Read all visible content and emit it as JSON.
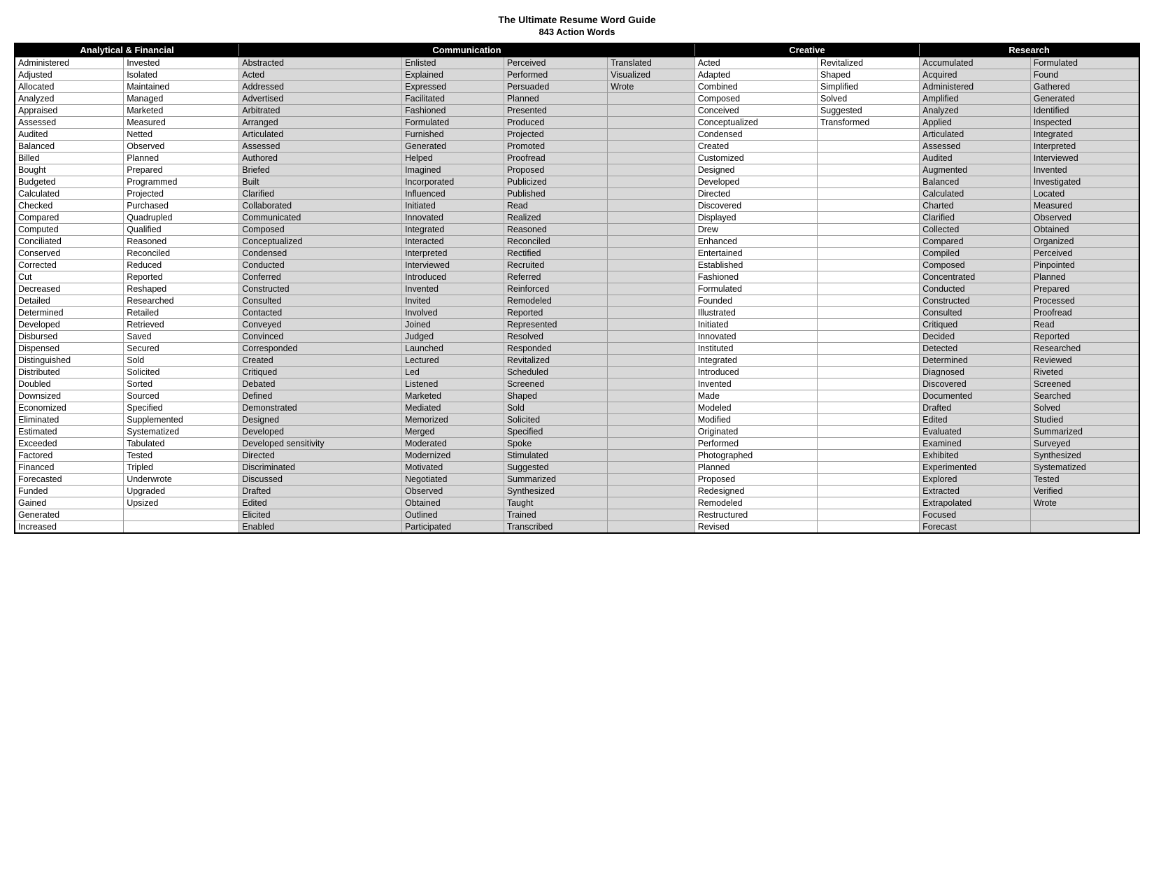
{
  "title": "The Ultimate Resume Word Guide",
  "subtitle": "843 Action Words",
  "sections": {
    "analytical": {
      "label": "Analytical & Financial",
      "col1": [
        "Administered",
        "Adjusted",
        "Allocated",
        "Analyzed",
        "Appraised",
        "Assessed",
        "Audited",
        "Balanced",
        "Billed",
        "Bought",
        "Budgeted",
        "Calculated",
        "Checked",
        "Compared",
        "Computed",
        "Conciliated",
        "Conserved",
        "Corrected",
        "Cut",
        "Decreased",
        "Detailed",
        "Determined",
        "Developed",
        "Disbursed",
        "Dispensed",
        "Distinguished",
        "Distributed",
        "Doubled",
        "Downsized",
        "Economized",
        "Eliminated",
        "Estimated",
        "Exceeded",
        "Factored",
        "Financed",
        "Forecasted",
        "Funded",
        "Gained",
        "Generated",
        "Increased"
      ],
      "col2": [
        "Invested",
        "Isolated",
        "Maintained",
        "Managed",
        "Marketed",
        "Measured",
        "Netted",
        "Observed",
        "Planned",
        "Prepared",
        "Programmed",
        "Projected",
        "Purchased",
        "Quadrupled",
        "Qualified",
        "Reasoned",
        "Reconciled",
        "Reduced",
        "Reported",
        "Reshaped",
        "Researched",
        "Retailed",
        "Retrieved",
        "Saved",
        "Secured",
        "Sold",
        "Solicited",
        "Sorted",
        "Sourced",
        "Specified",
        "Supplemented",
        "Systematized",
        "Tabulated",
        "Tested",
        "Tripled",
        "Underwrote",
        "Upgraded",
        "Upsized",
        "",
        ""
      ]
    },
    "communication": {
      "label": "Communication",
      "col1": [
        "Abstracted",
        "Acted",
        "Addressed",
        "Advertised",
        "Arbitrated",
        "Arranged",
        "Articulated",
        "Assessed",
        "Authored",
        "Briefed",
        "Built",
        "Clarified",
        "Collaborated",
        "Communicated",
        "Composed",
        "Conceptualized",
        "Condensed",
        "Conducted",
        "Conferred",
        "Constructed",
        "Consulted",
        "Contacted",
        "Conveyed",
        "Convinced",
        "Corresponded",
        "Created",
        "Critiqued",
        "Debated",
        "Defined",
        "Demonstrated",
        "Designed",
        "Developed",
        "Developed sensitivity",
        "Directed",
        "Discriminated",
        "Discussed",
        "Drafted",
        "Edited",
        "Elicited",
        "Enabled"
      ],
      "col2": [
        "Enlisted",
        "Explained",
        "Expressed",
        "Facilitated",
        "Fashioned",
        "Formulated",
        "Furnished",
        "Generated",
        "Helped",
        "Imagined",
        "Incorporated",
        "Influenced",
        "Initiated",
        "Innovated",
        "Integrated",
        "Interacted",
        "Interpreted",
        "Interviewed",
        "Introduced",
        "Invented",
        "Invited",
        "Involved",
        "Joined",
        "Judged",
        "Launched",
        "Lectured",
        "Led",
        "Listened",
        "Marketed",
        "Mediated",
        "Memorized",
        "Merged",
        "Moderated",
        "Modernized",
        "Motivated",
        "Negotiated",
        "Observed",
        "Obtained",
        "Outlined",
        "Participated"
      ],
      "col3": [
        "Perceived",
        "Performed",
        "Persuaded",
        "Planned",
        "Presented",
        "Produced",
        "Projected",
        "Promoted",
        "Proofread",
        "Proposed",
        "Publicized",
        "Published",
        "Read",
        "Realized",
        "Reasoned",
        "Reconciled",
        "Rectified",
        "Recruited",
        "Referred",
        "Reinforced",
        "Remodeled",
        "Reported",
        "Represented",
        "Resolved",
        "Responded",
        "Revitalized",
        "Scheduled",
        "Screened",
        "Shaped",
        "Sold",
        "Solicited",
        "Specified",
        "Spoke",
        "Stimulated",
        "Suggested",
        "Summarized",
        "Synthesized",
        "Taught",
        "Trained",
        "Transcribed"
      ],
      "col4": [
        "Translated",
        "Visualized",
        "Wrote",
        "",
        "",
        "",
        "",
        "",
        "",
        "",
        "",
        "",
        "",
        "",
        "",
        "",
        "",
        "",
        "",
        "",
        "",
        "",
        "",
        "",
        "",
        "",
        "",
        "",
        "",
        "",
        "",
        "",
        "",
        "",
        "",
        "",
        "",
        "",
        "",
        ""
      ]
    },
    "creative": {
      "label": "Creative",
      "col1": [
        "Acted",
        "Adapted",
        "Combined",
        "Composed",
        "Conceived",
        "Conceptualized",
        "Condensed",
        "Created",
        "Customized",
        "Designed",
        "Developed",
        "Directed",
        "Discovered",
        "Displayed",
        "Drew",
        "Enhanced",
        "Entertained",
        "Established",
        "Fashioned",
        "Formulated",
        "Founded",
        "Illustrated",
        "Initiated",
        "Innovated",
        "Instituted",
        "Integrated",
        "Introduced",
        "Invented",
        "Made",
        "Modeled",
        "Modified",
        "Originated",
        "Performed",
        "Photographed",
        "Planned",
        "Proposed",
        "Redesigned",
        "Remodeled",
        "Restructured",
        "Revised"
      ],
      "col2": [
        "Revitalized",
        "Shaped",
        "Simplified",
        "Solved",
        "Suggested",
        "Transformed",
        "",
        "",
        "",
        "",
        "",
        "",
        "",
        "",
        "",
        "",
        "",
        "",
        "",
        "",
        "",
        "",
        "",
        "",
        "",
        "",
        "",
        "",
        "",
        "",
        "",
        "",
        "",
        "",
        "",
        "",
        "",
        "",
        "",
        ""
      ]
    },
    "research": {
      "label": "Research",
      "col1": [
        "Accumulated",
        "Acquired",
        "Administered",
        "Amplified",
        "Analyzed",
        "Applied",
        "Articulated",
        "Assessed",
        "Audited",
        "Augmented",
        "Balanced",
        "Calculated",
        "Charted",
        "Clarified",
        "Collected",
        "Compared",
        "Compiled",
        "Composed",
        "Concentrated",
        "Conducted",
        "Constructed",
        "Consulted",
        "Critiqued",
        "Decided",
        "Detected",
        "Determined",
        "Diagnosed",
        "Discovered",
        "Documented",
        "Drafted",
        "Edited",
        "Evaluated",
        "Examined",
        "Exhibited",
        "Experimented",
        "Explored",
        "Extracted",
        "Extrapolated",
        "Focused",
        "Forecast"
      ],
      "col2": [
        "Formulated",
        "Found",
        "Gathered",
        "Generated",
        "Identified",
        "Inspected",
        "Integrated",
        "Interpreted",
        "Interviewed",
        "Invented",
        "Investigated",
        "Located",
        "Measured",
        "Observed",
        "Obtained",
        "Organized",
        "Perceived",
        "Pinpointed",
        "Planned",
        "Prepared",
        "Processed",
        "Proofread",
        "Read",
        "Reported",
        "Researched",
        "Reviewed",
        "Riveted",
        "Screened",
        "Searched",
        "Solved",
        "Studied",
        "Summarized",
        "Surveyed",
        "Synthesized",
        "Systematized",
        "Tested",
        "Verified",
        "Wrote",
        "",
        ""
      ]
    }
  }
}
